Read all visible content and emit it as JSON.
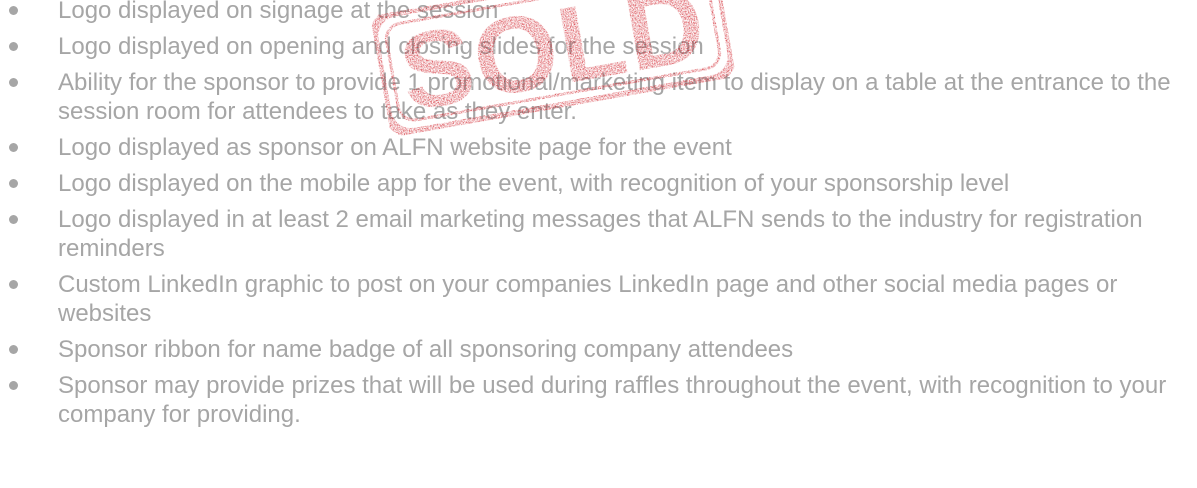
{
  "stamp": {
    "text": "SOLD",
    "color": "#d0212a"
  },
  "benefits": [
    "Logo displayed on signage at the session",
    "Logo displayed on opening and closing slides for the session",
    "Ability for the sponsor to provide 1 promotional/marketing item to display on a table at the entrance to the session room for attendees to take as they enter.",
    "Logo displayed as sponsor on ALFN website page for the event",
    "Logo displayed on the mobile app for the event, with recognition of your sponsorship level",
    "Logo displayed in at least 2 email marketing messages that ALFN sends to the industry for registration reminders",
    "Custom LinkedIn graphic to post on your companies LinkedIn page and other social media pages or websites",
    "Sponsor ribbon for name badge of all sponsoring company attendees",
    "Sponsor may provide prizes that will be used during raffles throughout the event, with recognition to your company for providing."
  ]
}
